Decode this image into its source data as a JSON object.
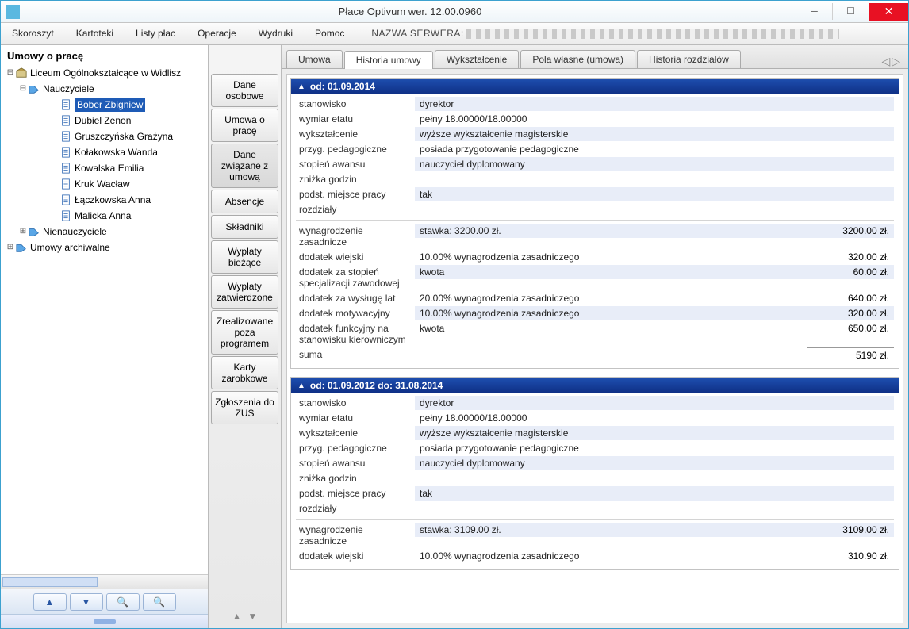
{
  "window": {
    "title": "Płace Optivum wer. 12.00.0960",
    "server_label": "NAZWA SERWERA:"
  },
  "menubar": [
    "Skoroszyt",
    "Kartoteki",
    "Listy płac",
    "Operacje",
    "Wydruki",
    "Pomoc"
  ],
  "tree": {
    "title": "Umowy o pracę",
    "root": "Liceum Ogólnokształcące w Widlisz",
    "group_teachers": "Nauczyciele",
    "teachers": [
      "Bober Zbigniew",
      "Dubiel Zenon",
      "Gruszczyńska Grażyna",
      "Kołakowska Wanda",
      "Kowalska Emilia",
      "Kruk Wacław",
      "Łączkowska Anna",
      "Malicka Anna"
    ],
    "group_nonteachers": "Nienauczyciele",
    "archive": "Umowy archiwalne"
  },
  "sidetabs": [
    "Dane osobowe",
    "Umowa o pracę",
    "Dane związane z umową",
    "Absencje",
    "Składniki",
    "Wypłaty bieżące",
    "Wypłaty zatwierdzone",
    "Zrealizowane poza programem",
    "Karty zarobkowe",
    "Zgłoszenia do ZUS"
  ],
  "maintabs": [
    "Umowa",
    "Historia umowy",
    "Wykształcenie",
    "Pola własne (umowa)",
    "Historia rozdziałów"
  ],
  "sections": [
    {
      "header": "od: 01.09.2014",
      "info": [
        {
          "l": "stanowisko",
          "v": "dyrektor"
        },
        {
          "l": "wymiar etatu",
          "v": "pełny 18.00000/18.00000"
        },
        {
          "l": "wykształcenie",
          "v": "wyższe wykształcenie magisterskie"
        },
        {
          "l": "przyg. pedagogiczne",
          "v": "posiada przygotowanie pedagogiczne"
        },
        {
          "l": "stopień awansu",
          "v": "nauczyciel dyplomowany"
        },
        {
          "l": "zniżka godzin",
          "v": ""
        },
        {
          "l": "podst. miejsce pracy",
          "v": "tak"
        },
        {
          "l": "rozdziały",
          "v": ""
        }
      ],
      "pay": [
        {
          "l": "wynagrodzenie zasadnicze",
          "v": "stawka: 3200.00 zł.",
          "a": "3200.00 zł."
        },
        {
          "l": "dodatek wiejski",
          "v": "10.00% wynagrodzenia zasadniczego",
          "a": "320.00 zł."
        },
        {
          "l": "dodatek za stopień specjalizacji zawodowej",
          "v": "kwota",
          "a": "60.00 zł."
        },
        {
          "l": "dodatek za wysługę lat",
          "v": "20.00% wynagrodzenia zasadniczego",
          "a": "640.00 zł."
        },
        {
          "l": "dodatek motywacyjny",
          "v": "10.00% wynagrodzenia zasadniczego",
          "a": "320.00 zł."
        },
        {
          "l": "dodatek funkcyjny na stanowisku kierowniczym",
          "v": "kwota",
          "a": "650.00 zł."
        }
      ],
      "sum_label": "suma",
      "sum": "5190 zł."
    },
    {
      "header": "od: 01.09.2012 do: 31.08.2014",
      "info": [
        {
          "l": "stanowisko",
          "v": "dyrektor"
        },
        {
          "l": "wymiar etatu",
          "v": "pełny 18.00000/18.00000"
        },
        {
          "l": "wykształcenie",
          "v": "wyższe wykształcenie magisterskie"
        },
        {
          "l": "przyg. pedagogiczne",
          "v": "posiada przygotowanie pedagogiczne"
        },
        {
          "l": "stopień awansu",
          "v": "nauczyciel dyplomowany"
        },
        {
          "l": "zniżka godzin",
          "v": ""
        },
        {
          "l": "podst. miejsce pracy",
          "v": "tak"
        },
        {
          "l": "rozdziały",
          "v": ""
        }
      ],
      "pay": [
        {
          "l": "wynagrodzenie zasadnicze",
          "v": "stawka: 3109.00 zł.",
          "a": "3109.00 zł."
        },
        {
          "l": "dodatek wiejski",
          "v": "10.00% wynagrodzenia zasadniczego",
          "a": "310.90 zł."
        }
      ]
    }
  ]
}
